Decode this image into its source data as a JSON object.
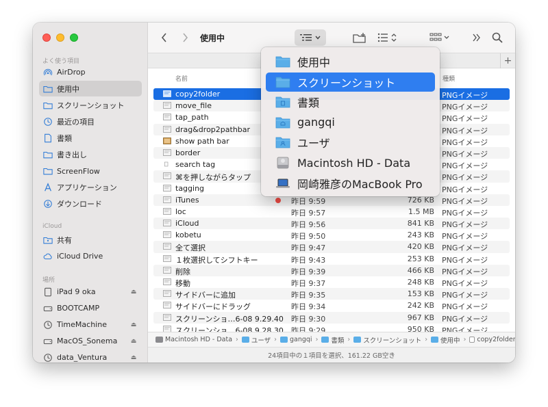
{
  "window": {
    "title": "使用中"
  },
  "sidebar": {
    "sections": [
      {
        "label": "よく使う項目"
      },
      {
        "label": "iCloud"
      },
      {
        "label": "場所"
      }
    ],
    "favorites": [
      {
        "label": "AirDrop",
        "icon": "airdrop-icon"
      },
      {
        "label": "使用中",
        "icon": "folder-icon",
        "selected": true
      },
      {
        "label": "スクリーンショット",
        "icon": "folder-icon"
      },
      {
        "label": "最近の項目",
        "icon": "clock-icon"
      },
      {
        "label": "書類",
        "icon": "document-icon"
      },
      {
        "label": "書き出し",
        "icon": "folder-icon"
      },
      {
        "label": "ScreenFlow",
        "icon": "folder-icon"
      },
      {
        "label": "アプリケーション",
        "icon": "applications-icon"
      },
      {
        "label": "ダウンロード",
        "icon": "download-icon"
      }
    ],
    "icloud": [
      {
        "label": "共有",
        "icon": "shared-folder-icon"
      },
      {
        "label": "iCloud Drive",
        "icon": "cloud-icon"
      }
    ],
    "locations": [
      {
        "label": "iPad 9 oka",
        "icon": "ipad-icon",
        "eject": true
      },
      {
        "label": "BOOTCAMP",
        "icon": "drive-icon",
        "eject": false
      },
      {
        "label": "TimeMachine",
        "icon": "timemachine-icon",
        "eject": true
      },
      {
        "label": "MacOS_Sonema",
        "icon": "drive-icon",
        "eject": true
      },
      {
        "label": "data_Ventura",
        "icon": "timemachine-icon",
        "eject": true
      }
    ]
  },
  "columns": {
    "name": "名前",
    "kind": "種類"
  },
  "files": [
    {
      "name": "copy2folder",
      "date": "",
      "size": "",
      "kind": "PNGイメージ",
      "selected": true
    },
    {
      "name": "move_file",
      "date": "",
      "size": "",
      "kind": "PNGイメージ"
    },
    {
      "name": "tap_path",
      "date": "",
      "size": "",
      "kind": "PNGイメージ"
    },
    {
      "name": "drag&drop2pathbar",
      "date": "",
      "size": "",
      "kind": "PNGイメージ"
    },
    {
      "name": "show path bar",
      "date": "",
      "size": "",
      "kind": "PNGイメージ"
    },
    {
      "name": "border",
      "date": "",
      "size": "",
      "kind": "PNGイメージ"
    },
    {
      "name": "search tag",
      "date": "",
      "size": "",
      "kind": "PNGイメージ"
    },
    {
      "name": "⌘を押しながらタップ",
      "date": "",
      "size": "",
      "kind": "PNGイメージ"
    },
    {
      "name": " tagging",
      "date": "",
      "size": "",
      "kind": "PNGイメージ"
    },
    {
      "name": "iTunes",
      "date": "昨日 9:59",
      "size": "726 KB",
      "kind": "PNGイメージ",
      "tag": true
    },
    {
      "name": "loc",
      "date": "昨日 9:57",
      "size": "1.5 MB",
      "kind": "PNGイメージ"
    },
    {
      "name": "iCloud",
      "date": "昨日 9:56",
      "size": "841 KB",
      "kind": "PNGイメージ"
    },
    {
      "name": " kobetu",
      "date": "昨日 9:50",
      "size": "243 KB",
      "kind": "PNGイメージ"
    },
    {
      "name": "全て選択",
      "date": "昨日 9:47",
      "size": "420 KB",
      "kind": "PNGイメージ"
    },
    {
      "name": "１枚選択してシフトキー",
      "date": "昨日 9:43",
      "size": "253 KB",
      "kind": "PNGイメージ"
    },
    {
      "name": "削除",
      "date": "昨日 9:39",
      "size": "466 KB",
      "kind": "PNGイメージ"
    },
    {
      "name": "移動",
      "date": "昨日 9:37",
      "size": "248 KB",
      "kind": "PNGイメージ"
    },
    {
      "name": "サイドバーに追加",
      "date": "昨日 9:35",
      "size": "153 KB",
      "kind": "PNGイメージ"
    },
    {
      "name": "サイドバーにドラッグ",
      "date": "昨日 9:34",
      "size": "242 KB",
      "kind": "PNGイメージ"
    },
    {
      "name": "スクリーンショ…6-08 9.29.40",
      "date": "昨日 9:30",
      "size": "967 KB",
      "kind": "PNGイメージ"
    },
    {
      "name": "スクリーンショ…6-08 9.28.30",
      "date": "昨日 9:29",
      "size": "950 KB",
      "kind": "PNGイメージ"
    }
  ],
  "pathbar": [
    {
      "label": "Macintosh HD - Data",
      "icon": "drive-icon"
    },
    {
      "label": "ユーザ",
      "icon": "folder-icon"
    },
    {
      "label": "gangqi",
      "icon": "home-folder-icon"
    },
    {
      "label": "書類",
      "icon": "folder-icon"
    },
    {
      "label": "スクリーンショット",
      "icon": "folder-icon"
    },
    {
      "label": "使用中",
      "icon": "folder-icon"
    },
    {
      "label": "copy2folder",
      "icon": "image-file-icon"
    }
  ],
  "status": "24項目中の１項目を選択、161.22 GB空き",
  "menu": {
    "items": [
      {
        "label": "使用中",
        "icon": "folder-icon"
      },
      {
        "label": "スクリーンショット",
        "icon": "folder-icon",
        "selected": true
      },
      {
        "label": "書類",
        "icon": "document-folder-icon"
      },
      {
        "label": "gangqi",
        "icon": "home-folder-icon"
      },
      {
        "label": "ユーザ",
        "icon": "users-folder-icon"
      },
      {
        "label": "Macintosh HD - Data",
        "icon": "hard-drive-icon"
      },
      {
        "label": "岡崎雅彦のMacBook Pro",
        "icon": "laptop-icon"
      }
    ]
  },
  "colors": {
    "selection": "#1a6ee3",
    "menu_selection": "#2f7ef0",
    "folder": "#5aaee8",
    "tag_red": "#ef4b44"
  }
}
